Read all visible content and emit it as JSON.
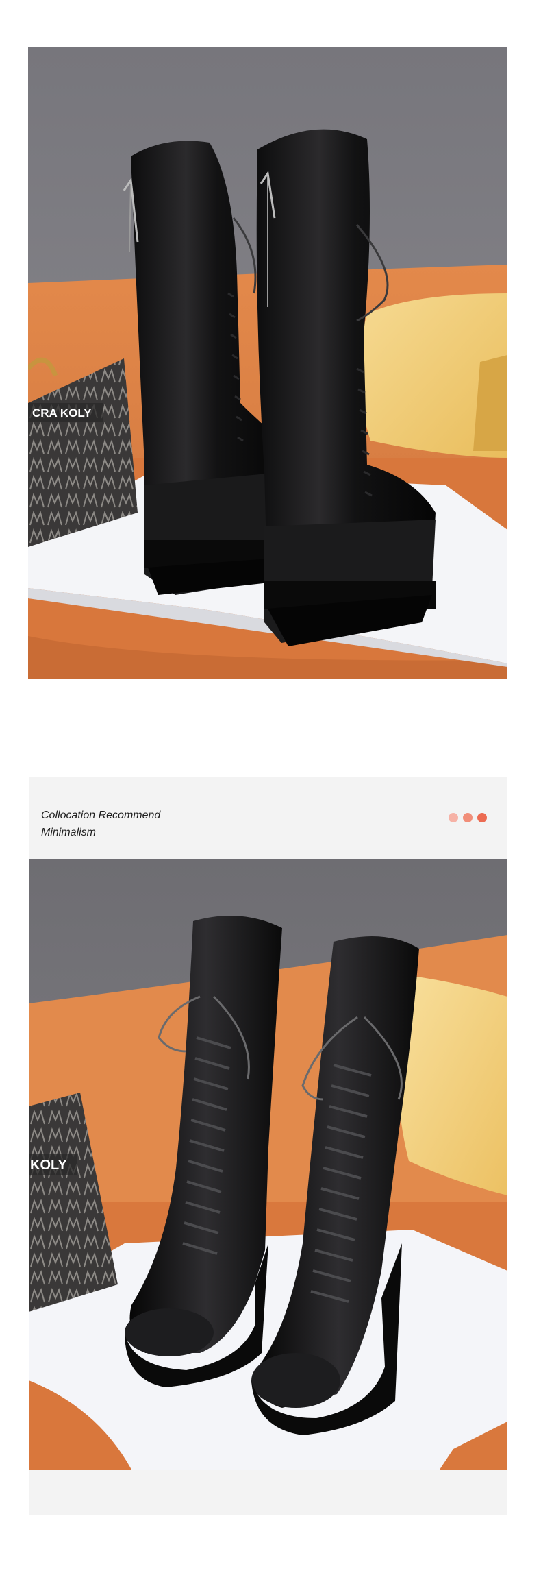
{
  "section": {
    "title_line1": "Collocation Recommend",
    "title_line2": "Minimalism",
    "dot_colors": [
      "#f6b2a6",
      "#f18e79",
      "#ec6b52"
    ]
  },
  "photo_top": {
    "bag_brand": "CRA KOLY"
  },
  "photo_bottom": {
    "bag_brand": "KOLY"
  }
}
